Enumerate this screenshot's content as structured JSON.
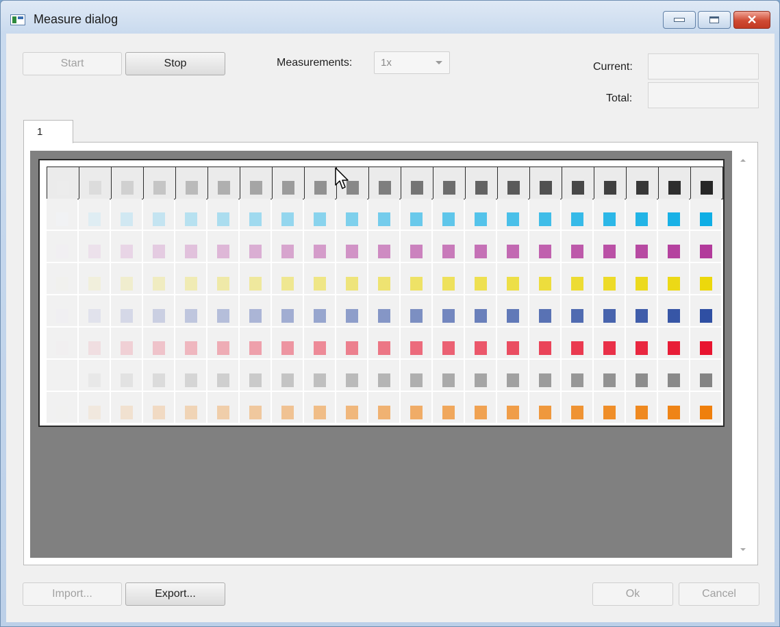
{
  "window": {
    "title": "Measure dialog"
  },
  "toolbar": {
    "start_label": "Start",
    "stop_label": "Stop",
    "measurements_label": "Measurements:",
    "measurements_value": "1x",
    "current_label": "Current:",
    "total_label": "Total:"
  },
  "tabs": [
    {
      "label": "1"
    }
  ],
  "footer": {
    "import_label": "Import...",
    "export_label": "Export...",
    "ok_label": "Ok",
    "cancel_label": "Cancel"
  },
  "chart": {
    "columns": 21,
    "rows": [
      {
        "name": "gray",
        "start": "#ececec",
        "end": "#262626"
      },
      {
        "name": "cyan",
        "start": "#f1f2f4",
        "end": "#0faee5"
      },
      {
        "name": "magenta",
        "start": "#f1eff2",
        "end": "#b23a9b"
      },
      {
        "name": "yellow",
        "start": "#f1f1ee",
        "end": "#ecd80c"
      },
      {
        "name": "blue",
        "start": "#f0eff2",
        "end": "#2f4fa3"
      },
      {
        "name": "red",
        "start": "#f1eff0",
        "end": "#e8142f"
      },
      {
        "name": "neutral-gray",
        "start": "#f1f1f1",
        "end": "#848484"
      },
      {
        "name": "orange",
        "start": "#f1f1f0",
        "end": "#ef7f0c"
      }
    ]
  }
}
